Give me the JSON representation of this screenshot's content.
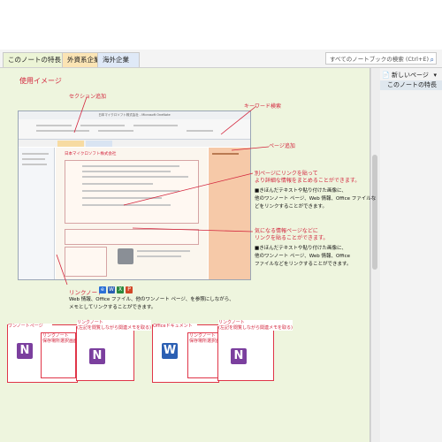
{
  "tabs": [
    {
      "label": "このノートの特長"
    },
    {
      "label": "外資系企業"
    },
    {
      "label": "海外企業"
    }
  ],
  "search": {
    "placeholder": "すべてのノートブックの検索 (Ctrl+E)"
  },
  "pagelist": {
    "new_page": "新しいページ",
    "current_page": "このノートの特長"
  },
  "content": {
    "heading": "使用イメージ",
    "callout_section": "セクション追加",
    "callout_keyword": "キーワード検索",
    "callout_page": "ページ追加",
    "note_link_title": "別ページにリンクを貼って\nより詳細な情報をまとめることができます。",
    "note_link_body": "■きほんだテキストや貼り付けた画像に、\n他のワンノート ページ、Web 情報、Office ファイルな\nどをリンクすることができます。",
    "note_info_title": "気になる情報ページなどに\nリンクを貼ることができます。",
    "note_info_body": "■きほんだテキストや貼り付けた画像に、\n他のワンノート ページ、Web 情報、Office\nファイルなどをリンクすることができます。",
    "linknote_title": "リンクノート",
    "linknote_body": "Web 情報、Office ファイル、他のワンノート ページ、を参照にしながら、\nメモとしてリンクすることができます。"
  },
  "screenshot": {
    "title": "日本マイクロソフト株式会社 - Microsoft OneNote",
    "company": "日本マイクロソフト株式会社"
  },
  "thumbs": {
    "t1": "ワンノートページ",
    "t2": "リンクノート\n保存場所選択画面",
    "t3": "リンクノート\n(左記を閲覧しながら関連メモを取る)",
    "t4": "Officeドキュメント",
    "t5": "リンクノート\n保存場所選択画面",
    "t6": "リンクノート\n(左記を閲覧しながら関連メモを取る)"
  },
  "colors": {
    "accent_red": "#d3243c",
    "page_bg": "#eef5de",
    "onenote_purple": "#7b3f9e",
    "word_blue": "#2b5fb3"
  }
}
